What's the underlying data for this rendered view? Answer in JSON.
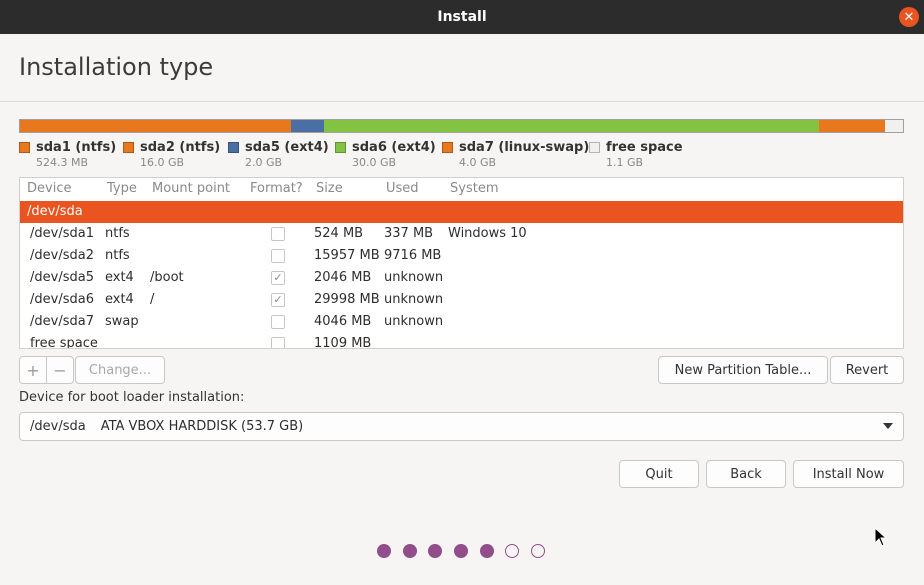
{
  "window": {
    "title": "Install"
  },
  "page": {
    "title": "Installation type"
  },
  "partition_bar": [
    {
      "name": "sda1 (ntfs)",
      "size": "524.3 MB",
      "color": "#e8781e"
    },
    {
      "name": "sda2 (ntfs)",
      "size": "16.0 GB",
      "color": "#e8781e"
    },
    {
      "name": "sda5 (ext4)",
      "size": "2.0 GB",
      "color": "#4a6fa5"
    },
    {
      "name": "sda6 (ext4)",
      "size": "30.0 GB",
      "color": "#82c341"
    },
    {
      "name": "sda7 (linux-swap)",
      "size": "4.0 GB",
      "color": "#e8781e"
    },
    {
      "name": "free space",
      "size": "1.1 GB",
      "color": "#f0f0f0"
    }
  ],
  "table": {
    "headers": [
      "Device",
      "Type",
      "Mount point",
      "Format?",
      "Size",
      "Used",
      "System"
    ],
    "disk": "/dev/sda",
    "rows": [
      {
        "device": "/dev/sda1",
        "type": "ntfs",
        "mount": "",
        "format": false,
        "size": "524 MB",
        "used": "337 MB",
        "system": "Windows 10"
      },
      {
        "device": "/dev/sda2",
        "type": "ntfs",
        "mount": "",
        "format": false,
        "size": "15957 MB",
        "used": "9716 MB",
        "system": ""
      },
      {
        "device": "/dev/sda5",
        "type": "ext4",
        "mount": "/boot",
        "format": true,
        "size": "2046 MB",
        "used": "unknown",
        "system": ""
      },
      {
        "device": "/dev/sda6",
        "type": "ext4",
        "mount": "/",
        "format": true,
        "size": "29998 MB",
        "used": "unknown",
        "system": ""
      },
      {
        "device": "/dev/sda7",
        "type": "swap",
        "mount": "",
        "format": false,
        "size": "4046 MB",
        "used": "unknown",
        "system": ""
      },
      {
        "device": "free space",
        "type": "",
        "mount": "",
        "format": false,
        "size": "1109 MB",
        "used": "",
        "system": ""
      }
    ]
  },
  "controls": {
    "add": "+",
    "remove": "−",
    "change": "Change...",
    "new_table": "New Partition Table...",
    "revert": "Revert"
  },
  "boot": {
    "label": "Device for boot loader installation:",
    "device": "/dev/sda",
    "description": "ATA VBOX HARDDISK (53.7 GB)"
  },
  "footer": {
    "quit": "Quit",
    "back": "Back",
    "install": "Install Now"
  },
  "progress": {
    "total": 7,
    "completed": 5
  },
  "colors": {
    "accent": "#e95420",
    "progress": "#924d8b"
  }
}
